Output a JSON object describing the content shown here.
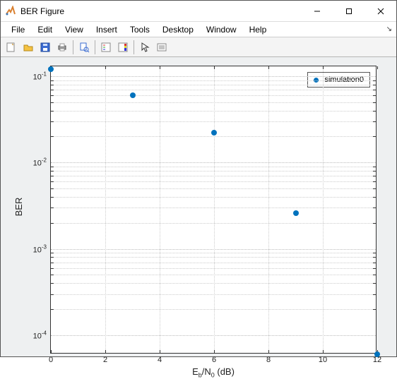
{
  "window": {
    "title": "BER Figure"
  },
  "menu": {
    "file": "File",
    "edit": "Edit",
    "view": "View",
    "insert": "Insert",
    "tools": "Tools",
    "desktop": "Desktop",
    "window": "Window",
    "help": "Help"
  },
  "toolbar_icons": {
    "new": "new-figure-icon",
    "open": "open-icon",
    "save": "save-icon",
    "print": "print-icon",
    "print_preview": "print-preview-icon",
    "legend": "legend-icon",
    "colorbar": "colorbar-icon",
    "cursor": "edit-plot-icon",
    "annotate": "insert-text-icon"
  },
  "axes": {
    "ylabel": "BER",
    "xlabel_prefix": "E",
    "xlabel_sub1": "b",
    "xlabel_mid": "/N",
    "xlabel_sub2": "0",
    "xlabel_suffix": " (dB)"
  },
  "legend": {
    "series0": "simulation0"
  },
  "yticks": [
    {
      "mantissa": "10",
      "exp": "-1"
    },
    {
      "mantissa": "10",
      "exp": "-2"
    },
    {
      "mantissa": "10",
      "exp": "-3"
    },
    {
      "mantissa": "10",
      "exp": "-4"
    }
  ],
  "xticks": {
    "t0": "0",
    "t1": "2",
    "t2": "4",
    "t3": "6",
    "t4": "8",
    "t5": "10",
    "t6": "12"
  },
  "chart_data": {
    "type": "scatter",
    "xlabel": "E_b/N_0 (dB)",
    "ylabel": "BER",
    "xlim": [
      0,
      12
    ],
    "ylim": [
      6e-05,
      0.13
    ],
    "yscale": "log",
    "legend_position": "upper right",
    "grid": true,
    "series": [
      {
        "name": "simulation0",
        "x": [
          0,
          3,
          6,
          9,
          12
        ],
        "y": [
          0.12,
          0.06,
          0.022,
          0.0026,
          6e-05
        ],
        "marker": "o",
        "color": "#0072bd"
      }
    ]
  }
}
